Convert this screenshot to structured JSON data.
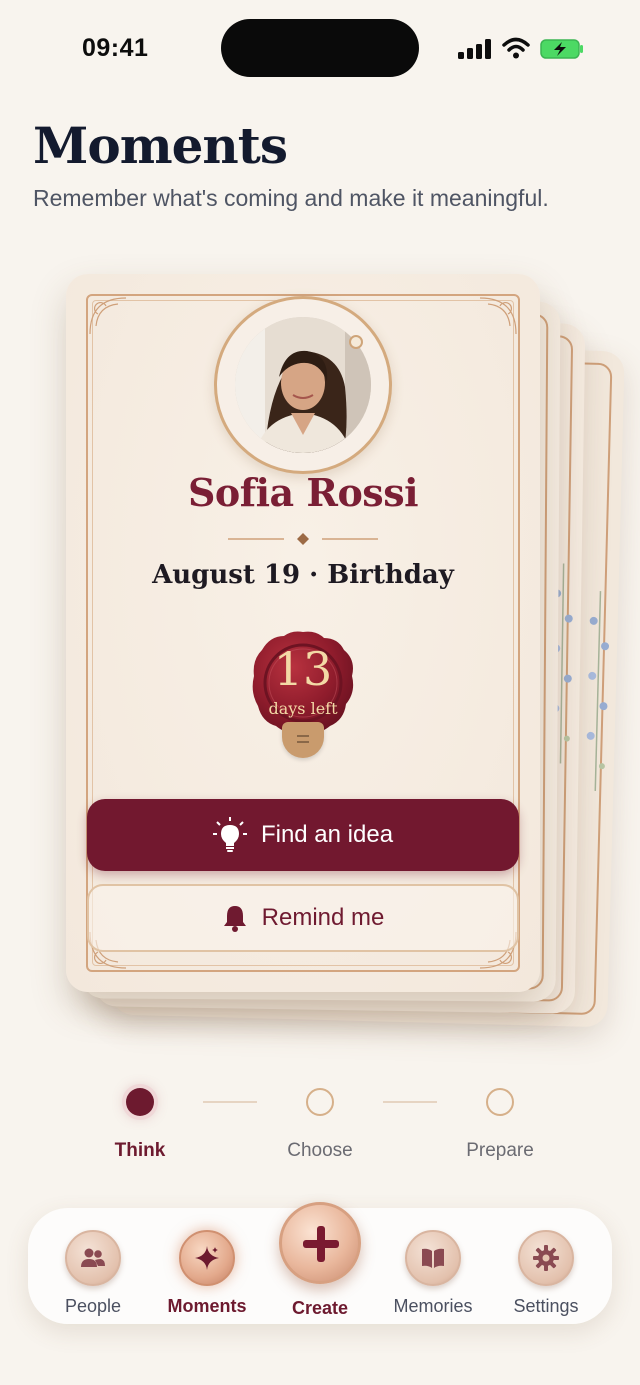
{
  "status_bar": {
    "time": "09:41"
  },
  "header": {
    "title": "Moments",
    "subtitle": "Remember what's coming and make it meaningful."
  },
  "card": {
    "name": "Sofia Rossi",
    "occasion": "August 19 · Birthday",
    "days_number": "13",
    "days_label": "days left",
    "primary_button": "Find an idea",
    "secondary_button": "Remind me"
  },
  "stepper": {
    "steps": [
      {
        "label": "Think",
        "active": true
      },
      {
        "label": "Choose",
        "active": false
      },
      {
        "label": "Prepare",
        "active": false
      }
    ]
  },
  "tabbar": {
    "tabs": [
      {
        "label": "People",
        "icon": "people-icon"
      },
      {
        "label": "Moments",
        "icon": "sparkle-icon",
        "active": true
      },
      {
        "label": "Create",
        "icon": "plus-icon"
      },
      {
        "label": "Memories",
        "icon": "book-icon"
      },
      {
        "label": "Settings",
        "icon": "gear-icon"
      }
    ]
  },
  "colors": {
    "accent": "#72182f",
    "gold": "#d3a57f",
    "background": "#f8f4ee"
  }
}
